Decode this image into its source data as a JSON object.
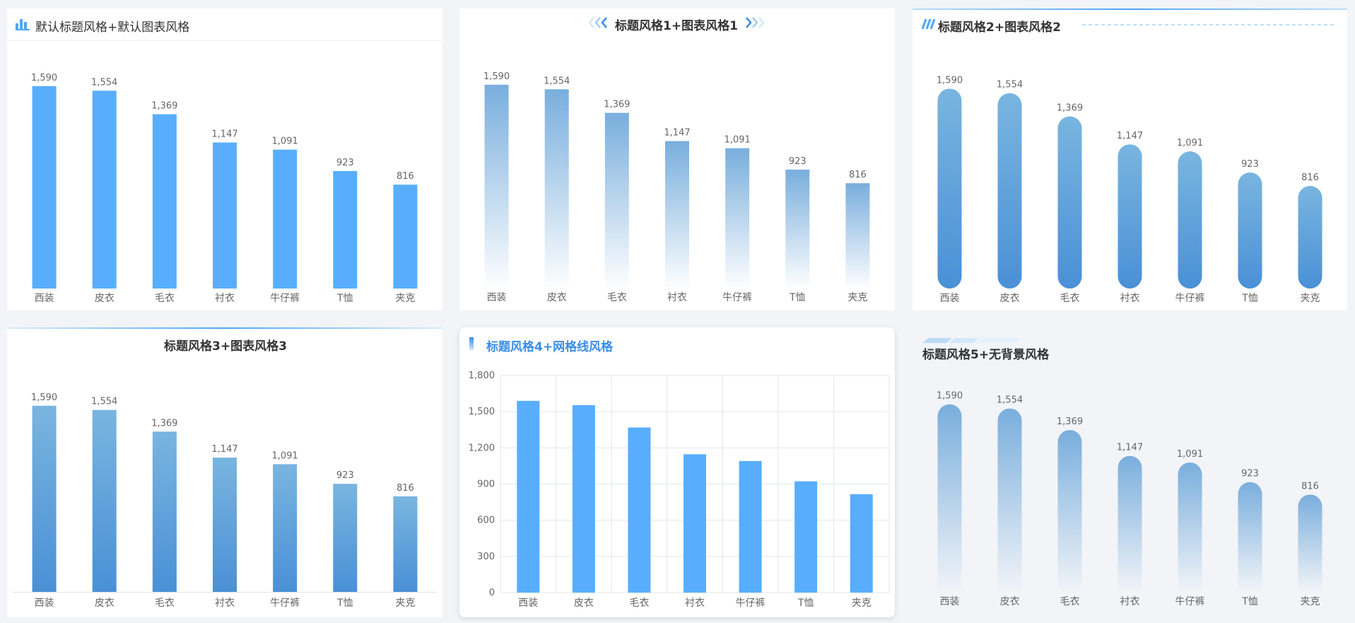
{
  "colors": {
    "accent": "#4da7f7",
    "bar_solid": "#58aefd",
    "grad_top": "#79b5e0",
    "grad_bottom": "#4a90d6",
    "fade_top": "#79aedd",
    "axis_text": "#666666",
    "value_text": "#666666"
  },
  "panels": [
    {
      "title": "默认标题风格+默认图表风格"
    },
    {
      "title": "标题风格1+图表风格1"
    },
    {
      "title": "标题风格2+图表风格2"
    },
    {
      "title": "标题风格3+图表风格3"
    },
    {
      "title": "标题风格4+网格线风格"
    },
    {
      "title": "标题风格5+无背景风格"
    }
  ],
  "chart_data": [
    {
      "type": "bar",
      "categories": [
        "西装",
        "皮衣",
        "毛衣",
        "衬衣",
        "牛仔裤",
        "T恤",
        "夹克"
      ],
      "values": [
        1590,
        1554,
        1369,
        1147,
        1091,
        923,
        816
      ],
      "value_labels": [
        "1,590",
        "1,554",
        "1,369",
        "1,147",
        "1,091",
        "923",
        "816"
      ],
      "title": "默认标题风格+默认图表风格",
      "ylim": [
        0,
        1800
      ],
      "style": "solid",
      "grid": false
    },
    {
      "type": "bar",
      "categories": [
        "西装",
        "皮衣",
        "毛衣",
        "衬衣",
        "牛仔裤",
        "T恤",
        "夹克"
      ],
      "values": [
        1590,
        1554,
        1369,
        1147,
        1091,
        923,
        816
      ],
      "value_labels": [
        "1,590",
        "1,554",
        "1,369",
        "1,147",
        "1,091",
        "923",
        "816"
      ],
      "title": "标题风格1+图表风格1",
      "ylim": [
        0,
        1800
      ],
      "style": "fade-gradient",
      "grid": false
    },
    {
      "type": "bar",
      "categories": [
        "西装",
        "皮衣",
        "毛衣",
        "衬衣",
        "牛仔裤",
        "T恤",
        "夹克"
      ],
      "values": [
        1590,
        1554,
        1369,
        1147,
        1091,
        923,
        816
      ],
      "value_labels": [
        "1,590",
        "1,554",
        "1,369",
        "1,147",
        "1,091",
        "923",
        "816"
      ],
      "title": "标题风格2+图表风格2",
      "ylim": [
        0,
        1800
      ],
      "style": "rounded-gradient",
      "grid": false
    },
    {
      "type": "bar",
      "categories": [
        "西装",
        "皮衣",
        "毛衣",
        "衬衣",
        "牛仔裤",
        "T恤",
        "夹克"
      ],
      "values": [
        1590,
        1554,
        1369,
        1147,
        1091,
        923,
        816
      ],
      "value_labels": [
        "1,590",
        "1,554",
        "1,369",
        "1,147",
        "1,091",
        "923",
        "816"
      ],
      "title": "标题风格3+图表风格3",
      "ylim": [
        0,
        1800
      ],
      "style": "gradient",
      "grid": false
    },
    {
      "type": "bar",
      "categories": [
        "西装",
        "皮衣",
        "毛衣",
        "衬衣",
        "牛仔裤",
        "T恤",
        "夹克"
      ],
      "values": [
        1590,
        1554,
        1369,
        1147,
        1091,
        923,
        816
      ],
      "title": "标题风格4+网格线风格",
      "ylim": [
        0,
        1800
      ],
      "yticks": [
        0,
        300,
        600,
        900,
        1200,
        1500,
        1800
      ],
      "ytick_labels": [
        "0",
        "300",
        "600",
        "900",
        "1,200",
        "1,500",
        "1,800"
      ],
      "style": "solid",
      "grid": true
    },
    {
      "type": "bar",
      "categories": [
        "西装",
        "皮衣",
        "毛衣",
        "衬衣",
        "牛仔裤",
        "T恤",
        "夹克"
      ],
      "values": [
        1590,
        1554,
        1369,
        1147,
        1091,
        923,
        816
      ],
      "value_labels": [
        "1,590",
        "1,554",
        "1,369",
        "1,147",
        "1,091",
        "923",
        "816"
      ],
      "title": "标题风格5+无背景风格",
      "ylim": [
        0,
        1800
      ],
      "style": "rounded-fade",
      "grid": false
    }
  ]
}
